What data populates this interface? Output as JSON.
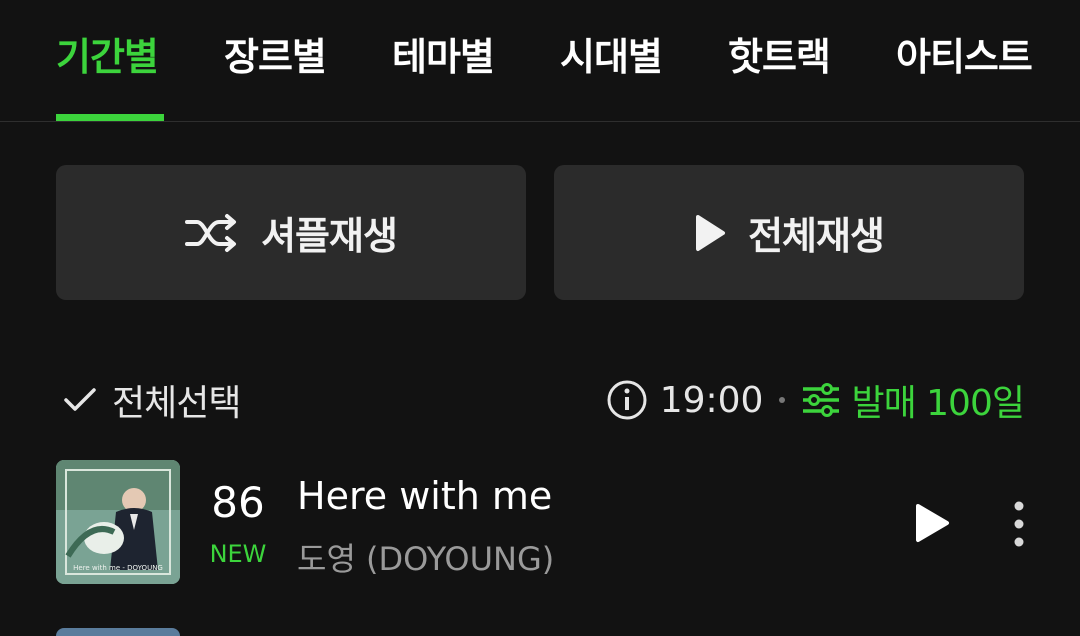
{
  "tabs": [
    {
      "label": "기간별",
      "active": true
    },
    {
      "label": "장르별",
      "active": false
    },
    {
      "label": "테마별",
      "active": false
    },
    {
      "label": "시대별",
      "active": false
    },
    {
      "label": "핫트랙",
      "active": false
    },
    {
      "label": "아티스트",
      "active": false
    }
  ],
  "actions": {
    "shuffle_label": "셔플재생",
    "play_all_label": "전체재생"
  },
  "selection": {
    "select_all_label": "전체선택",
    "time": "19:00",
    "filter_label": "발매 100일"
  },
  "tracks": [
    {
      "rank": "86",
      "badge": "NEW",
      "title": "Here with me",
      "artist": "도영 (DOYOUNG)",
      "cover_caption": "Here with me - DOYOUNG"
    }
  ],
  "colors": {
    "accent": "#3cd43c",
    "background": "#121212",
    "button_bg": "#2b2b2b",
    "secondary_text": "#9a9a9a"
  },
  "icons": {
    "shuffle": "shuffle-icon",
    "play": "play-icon",
    "check": "check-icon",
    "info": "info-icon",
    "filter": "filter-sliders-icon",
    "more": "more-vertical-icon"
  }
}
